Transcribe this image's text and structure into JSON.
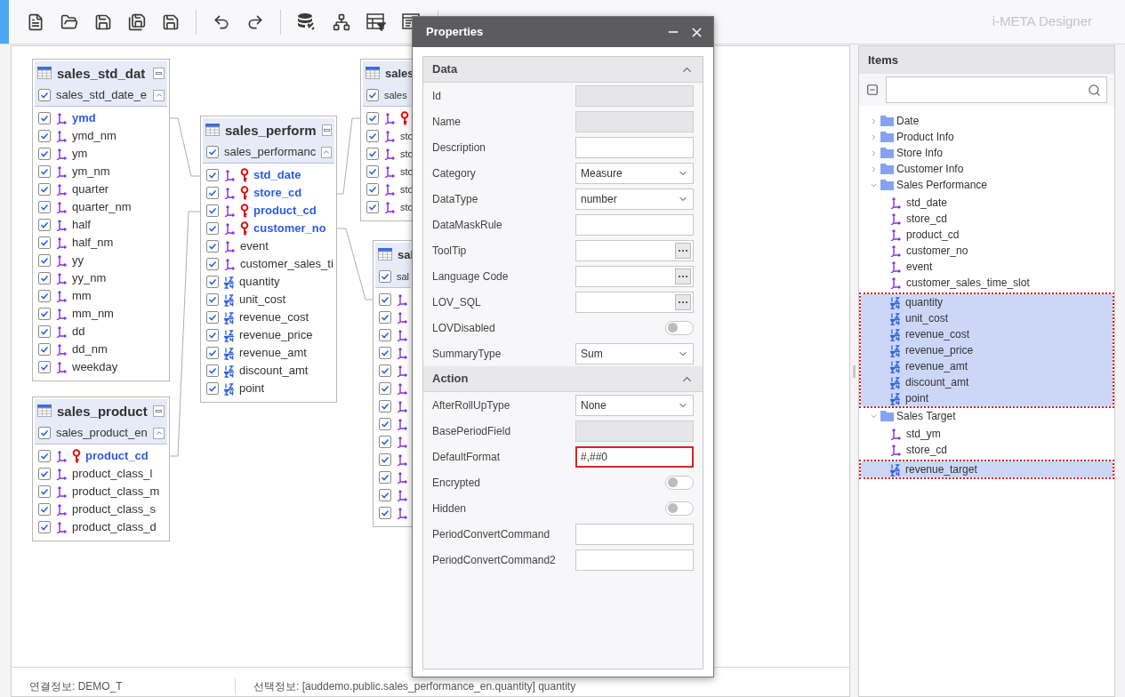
{
  "toolbar": {
    "app_title": "i-META Designer"
  },
  "canvas": {
    "tables": [
      {
        "title": "sales_std_dat",
        "subtitle": "sales_std_date_e",
        "checked": true,
        "columns": [
          {
            "name": "ymd",
            "kind": "dimension",
            "key": false,
            "linked": true,
            "checked": true
          },
          {
            "name": "ymd_nm",
            "kind": "dimension",
            "key": false,
            "linked": false,
            "checked": true
          },
          {
            "name": "ym",
            "kind": "dimension",
            "key": false,
            "linked": false,
            "checked": true
          },
          {
            "name": "ym_nm",
            "kind": "dimension",
            "key": false,
            "linked": false,
            "checked": true
          },
          {
            "name": "quarter",
            "kind": "dimension",
            "key": false,
            "linked": false,
            "checked": true
          },
          {
            "name": "quarter_nm",
            "kind": "dimension",
            "key": false,
            "linked": false,
            "checked": true
          },
          {
            "name": "half",
            "kind": "dimension",
            "key": false,
            "linked": false,
            "checked": true
          },
          {
            "name": "half_nm",
            "kind": "dimension",
            "key": false,
            "linked": false,
            "checked": true
          },
          {
            "name": "yy",
            "kind": "dimension",
            "key": false,
            "linked": false,
            "checked": true
          },
          {
            "name": "yy_nm",
            "kind": "dimension",
            "key": false,
            "linked": false,
            "checked": true
          },
          {
            "name": "mm",
            "kind": "dimension",
            "key": false,
            "linked": false,
            "checked": true
          },
          {
            "name": "mm_nm",
            "kind": "dimension",
            "key": false,
            "linked": false,
            "checked": true
          },
          {
            "name": "dd",
            "kind": "dimension",
            "key": false,
            "linked": false,
            "checked": true
          },
          {
            "name": "dd_nm",
            "kind": "dimension",
            "key": false,
            "linked": false,
            "checked": true
          },
          {
            "name": "weekday",
            "kind": "dimension",
            "key": false,
            "linked": false,
            "checked": true
          }
        ]
      },
      {
        "title": "sales_product",
        "subtitle": "sales_product_en",
        "checked": true,
        "columns": [
          {
            "name": "product_cd",
            "kind": "dimension",
            "key": true,
            "linked": true,
            "checked": true
          },
          {
            "name": "product_class_l",
            "kind": "dimension",
            "key": false,
            "linked": false,
            "checked": true
          },
          {
            "name": "product_class_m",
            "kind": "dimension",
            "key": false,
            "linked": false,
            "checked": true
          },
          {
            "name": "product_class_s",
            "kind": "dimension",
            "key": false,
            "linked": false,
            "checked": true
          },
          {
            "name": "product_class_d",
            "kind": "dimension",
            "key": false,
            "linked": false,
            "checked": true
          }
        ]
      },
      {
        "title": "sales_perform",
        "subtitle": "sales_performanc",
        "checked": true,
        "columns": [
          {
            "name": "std_date",
            "kind": "dimension",
            "key": true,
            "linked": true,
            "checked": true
          },
          {
            "name": "store_cd",
            "kind": "dimension",
            "key": true,
            "linked": true,
            "checked": true
          },
          {
            "name": "product_cd",
            "kind": "dimension",
            "key": true,
            "linked": true,
            "checked": true
          },
          {
            "name": "customer_no",
            "kind": "dimension",
            "key": true,
            "linked": true,
            "checked": true
          },
          {
            "name": "event",
            "kind": "dimension",
            "key": false,
            "linked": false,
            "checked": true
          },
          {
            "name": "customer_sales_ti",
            "kind": "dimension",
            "key": false,
            "linked": false,
            "checked": true
          },
          {
            "name": "quantity",
            "kind": "measure",
            "key": false,
            "linked": false,
            "checked": true
          },
          {
            "name": "unit_cost",
            "kind": "measure",
            "key": false,
            "linked": false,
            "checked": true
          },
          {
            "name": "revenue_cost",
            "kind": "measure",
            "key": false,
            "linked": false,
            "checked": true
          },
          {
            "name": "revenue_price",
            "kind": "measure",
            "key": false,
            "linked": false,
            "checked": true
          },
          {
            "name": "revenue_amt",
            "kind": "measure",
            "key": false,
            "linked": false,
            "checked": true
          },
          {
            "name": "discount_amt",
            "kind": "measure",
            "key": false,
            "linked": false,
            "checked": true
          },
          {
            "name": "point",
            "kind": "measure",
            "key": false,
            "linked": false,
            "checked": true
          }
        ]
      },
      {
        "title": "sales",
        "subtitle": "sales",
        "checked": true,
        "columns": [
          {
            "kind": "dimension",
            "key": true,
            "checked": true
          },
          {
            "name": "sto",
            "kind": "dimension",
            "key": false,
            "linked": false,
            "checked": true
          },
          {
            "name": "sto",
            "kind": "dimension",
            "key": false,
            "linked": false,
            "checked": true
          },
          {
            "name": "sto",
            "kind": "dimension",
            "key": false,
            "linked": false,
            "checked": true
          },
          {
            "name": "sto",
            "kind": "dimension",
            "key": false,
            "linked": false,
            "checked": true
          },
          {
            "name": "sto",
            "kind": "dimension",
            "key": false,
            "linked": false,
            "checked": true
          }
        ]
      },
      {
        "title": "sal",
        "subtitle": "sal",
        "checked": true,
        "columns": [
          {
            "kind": "dimension",
            "checked": true
          },
          {
            "kind": "dimension",
            "checked": true
          },
          {
            "kind": "dimension",
            "checked": true
          },
          {
            "kind": "dimension",
            "checked": true
          },
          {
            "kind": "dimension",
            "checked": true
          },
          {
            "kind": "dimension",
            "checked": true
          },
          {
            "kind": "dimension",
            "checked": true
          },
          {
            "kind": "dimension",
            "checked": true
          },
          {
            "kind": "dimension",
            "checked": true
          },
          {
            "kind": "dimension",
            "checked": true
          },
          {
            "kind": "dimension",
            "checked": true
          },
          {
            "kind": "dimension",
            "checked": true
          },
          {
            "kind": "dimension",
            "checked": true
          }
        ]
      }
    ]
  },
  "status_bar": {
    "connection": "연결정보: DEMO_T",
    "selection": "선택정보: [auddemo.public.sales_performance_en.quantity] quantity"
  },
  "properties": {
    "title": "Properties",
    "sections": [
      {
        "title": "Data",
        "expanded": true,
        "rows": [
          {
            "label": "Id",
            "kind": "readonly"
          },
          {
            "label": "Name",
            "kind": "readonly"
          },
          {
            "label": "Description",
            "kind": "text"
          },
          {
            "label": "Category",
            "kind": "select",
            "value": "Measure"
          },
          {
            "label": "DataType",
            "kind": "select",
            "value": "number"
          },
          {
            "label": "DataMaskRule",
            "kind": "text"
          },
          {
            "label": "ToolTip",
            "kind": "ellipsis"
          },
          {
            "label": "Language Code",
            "kind": "ellipsis"
          },
          {
            "label": "LOV_SQL",
            "kind": "ellipsis"
          },
          {
            "label": "LOVDisabled",
            "kind": "toggle",
            "on": false
          },
          {
            "label": "SummaryType",
            "kind": "select",
            "value": "Sum"
          }
        ]
      },
      {
        "title": "Action",
        "expanded": true,
        "rows": [
          {
            "label": "AfterRollUpType",
            "kind": "select",
            "value": "None"
          },
          {
            "label": "BasePeriodField",
            "kind": "readonly"
          },
          {
            "label": "DefaultFormat",
            "kind": "text",
            "value": "#,##0",
            "focused": true
          },
          {
            "label": "Encrypted",
            "kind": "toggle",
            "on": false
          },
          {
            "label": "Hidden",
            "kind": "toggle",
            "on": false
          },
          {
            "label": "PeriodConvertCommand",
            "kind": "text"
          },
          {
            "label": "PeriodConvertCommand2",
            "kind": "text"
          }
        ]
      }
    ]
  },
  "items_panel": {
    "title": "Items",
    "tree": [
      {
        "label": "Date",
        "kind": "folder",
        "expanded": false
      },
      {
        "label": "Product Info",
        "kind": "folder",
        "expanded": false
      },
      {
        "label": "Store Info",
        "kind": "folder",
        "expanded": false
      },
      {
        "label": "Customer Info",
        "kind": "folder",
        "expanded": false
      },
      {
        "label": "Sales Performance",
        "kind": "folder",
        "expanded": true,
        "children": [
          {
            "label": "std_date",
            "kind": "dimension",
            "selected": false
          },
          {
            "label": "store_cd",
            "kind": "dimension",
            "selected": false
          },
          {
            "label": "product_cd",
            "kind": "dimension",
            "selected": false
          },
          {
            "label": "customer_no",
            "kind": "dimension",
            "selected": false
          },
          {
            "label": "event",
            "kind": "dimension",
            "selected": false
          },
          {
            "label": "customer_sales_time_slot",
            "kind": "dimension",
            "selected": false
          },
          {
            "label": "quantity",
            "kind": "measure",
            "selected": true
          },
          {
            "label": "unit_cost",
            "kind": "measure",
            "selected": true
          },
          {
            "label": "revenue_cost",
            "kind": "measure",
            "selected": true
          },
          {
            "label": "revenue_price",
            "kind": "measure",
            "selected": true
          },
          {
            "label": "revenue_amt",
            "kind": "measure",
            "selected": true
          },
          {
            "label": "discount_amt",
            "kind": "measure",
            "selected": true
          },
          {
            "label": "point",
            "kind": "measure",
            "selected": true
          }
        ]
      },
      {
        "label": "Sales Target",
        "kind": "folder",
        "expanded": true,
        "children": [
          {
            "label": "std_ym",
            "kind": "dimension",
            "selected": false
          },
          {
            "label": "store_cd",
            "kind": "dimension",
            "selected": false
          },
          {
            "label": "revenue_target",
            "kind": "measure",
            "selected": true
          }
        ]
      }
    ]
  }
}
